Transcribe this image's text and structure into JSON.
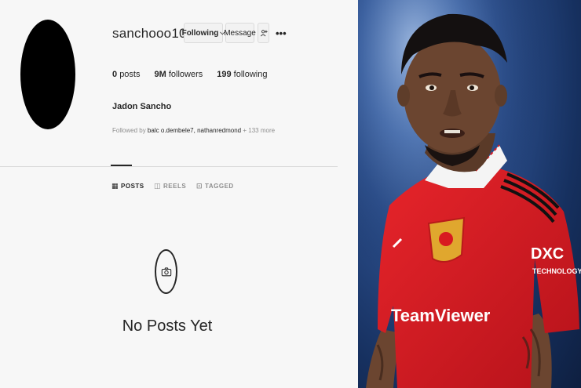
{
  "profile": {
    "username": "sanchooo10",
    "buttons": {
      "following": "Following",
      "message": "Message"
    },
    "stats": [
      {
        "num": "0",
        "label": "posts"
      },
      {
        "num": "9M",
        "label": "followers"
      },
      {
        "num": "199",
        "label": "following"
      }
    ],
    "full_name": "Jadon Sancho",
    "followed_by": {
      "prefix": "Followed by",
      "names": "balc o.dembele7, nathanredmond",
      "more": "+ 133 more"
    }
  },
  "tabs": [
    {
      "label": "POSTS"
    },
    {
      "label": "REELS"
    },
    {
      "label": "TAGGED"
    }
  ],
  "empty_state": {
    "text": "No Posts Yet"
  },
  "photo": {
    "shirt_sponsor": "TeamViewer",
    "sleeve_sponsor": {
      "logo": "DXC",
      "text": "TECHNOLOGY"
    }
  },
  "colors": {
    "verified": "#3897f0",
    "shirt_red": "#d81920",
    "background_blue": "#1f3f7a"
  }
}
